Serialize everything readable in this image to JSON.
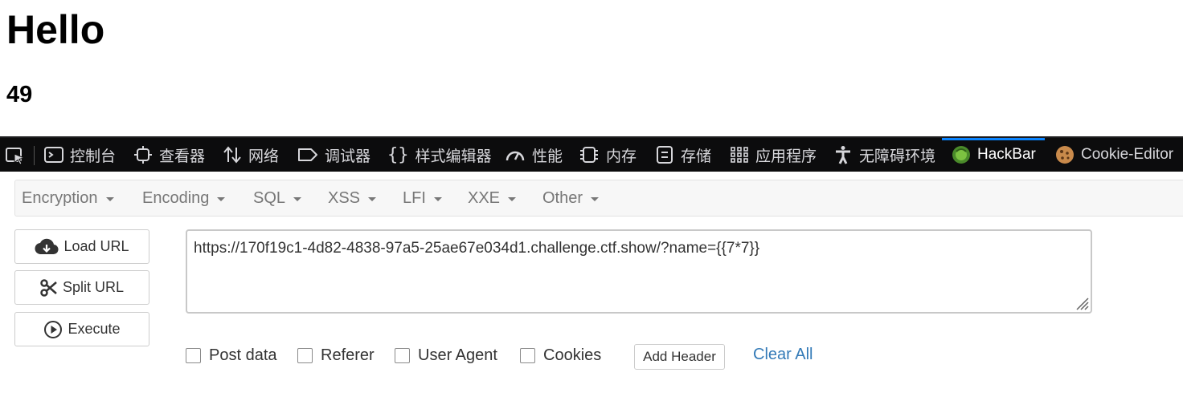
{
  "page": {
    "heading": "Hello",
    "result": "49"
  },
  "devtools": {
    "tabs": [
      {
        "label": "控制台",
        "icon": "console-icon"
      },
      {
        "label": "查看器",
        "icon": "inspector-icon"
      },
      {
        "label": "网络",
        "icon": "network-icon"
      },
      {
        "label": "调试器",
        "icon": "debugger-icon"
      },
      {
        "label": "样式编辑器",
        "icon": "style-editor-icon"
      },
      {
        "label": "性能",
        "icon": "performance-icon"
      },
      {
        "label": "内存",
        "icon": "memory-icon"
      },
      {
        "label": "存储",
        "icon": "storage-icon"
      },
      {
        "label": "应用程序",
        "icon": "application-icon"
      },
      {
        "label": "无障碍环境",
        "icon": "accessibility-icon"
      },
      {
        "label": "HackBar",
        "icon": "hackbar-icon"
      },
      {
        "label": "Cookie-Editor",
        "icon": "cookie-icon"
      }
    ],
    "active_tab": "HackBar",
    "accent": "#0a84ff"
  },
  "hackbar": {
    "menu": [
      "Encryption",
      "Encoding",
      "SQL",
      "XSS",
      "LFI",
      "XXE",
      "Other"
    ],
    "buttons": {
      "load_url": "Load URL",
      "split_url": "Split URL",
      "execute": "Execute"
    },
    "url": "https://170f19c1-4d82-4838-97a5-25ae67e034d1.challenge.ctf.show/?name={{7*7}}",
    "options": {
      "post_data": "Post data",
      "referer": "Referer",
      "user_agent": "User Agent",
      "cookies": "Cookies"
    },
    "add_header": "Add Header",
    "clear_all": "Clear All",
    "link_color": "#337ab7"
  }
}
